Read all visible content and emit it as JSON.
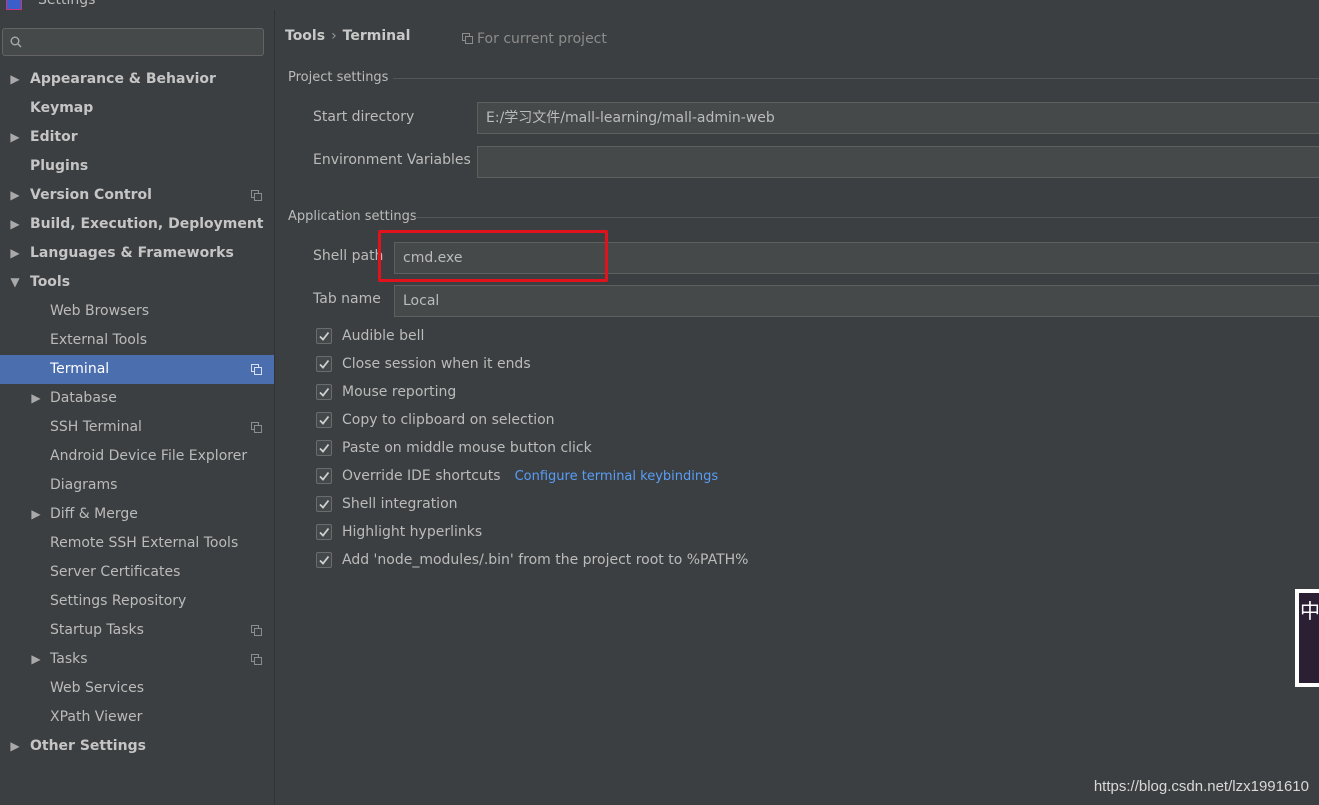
{
  "window": {
    "title": "Settings"
  },
  "search": {
    "placeholder": ""
  },
  "tree": [
    {
      "label": "Appearance & Behavior",
      "arrow": "▶",
      "level": 0,
      "selected": false,
      "project": false
    },
    {
      "label": "Keymap",
      "arrow": "",
      "level": 0,
      "selected": false,
      "project": false
    },
    {
      "label": "Editor",
      "arrow": "▶",
      "level": 0,
      "selected": false,
      "project": false
    },
    {
      "label": "Plugins",
      "arrow": "",
      "level": 0,
      "selected": false,
      "project": false
    },
    {
      "label": "Version Control",
      "arrow": "▶",
      "level": 0,
      "selected": false,
      "project": true
    },
    {
      "label": "Build, Execution, Deployment",
      "arrow": "▶",
      "level": 0,
      "selected": false,
      "project": false
    },
    {
      "label": "Languages & Frameworks",
      "arrow": "▶",
      "level": 0,
      "selected": false,
      "project": false
    },
    {
      "label": "Tools",
      "arrow": "▼",
      "level": 0,
      "selected": false,
      "project": false
    },
    {
      "label": "Web Browsers",
      "arrow": "",
      "level": 1,
      "selected": false,
      "project": false
    },
    {
      "label": "External Tools",
      "arrow": "",
      "level": 1,
      "selected": false,
      "project": false
    },
    {
      "label": "Terminal",
      "arrow": "",
      "level": 1,
      "selected": true,
      "project": true
    },
    {
      "label": "Database",
      "arrow": "▶",
      "level": 1,
      "selected": false,
      "project": false
    },
    {
      "label": "SSH Terminal",
      "arrow": "",
      "level": 1,
      "selected": false,
      "project": true
    },
    {
      "label": "Android Device File Explorer",
      "arrow": "",
      "level": 1,
      "selected": false,
      "project": false
    },
    {
      "label": "Diagrams",
      "arrow": "",
      "level": 1,
      "selected": false,
      "project": false
    },
    {
      "label": "Diff & Merge",
      "arrow": "▶",
      "level": 1,
      "selected": false,
      "project": false
    },
    {
      "label": "Remote SSH External Tools",
      "arrow": "",
      "level": 1,
      "selected": false,
      "project": false
    },
    {
      "label": "Server Certificates",
      "arrow": "",
      "level": 1,
      "selected": false,
      "project": false
    },
    {
      "label": "Settings Repository",
      "arrow": "",
      "level": 1,
      "selected": false,
      "project": false
    },
    {
      "label": "Startup Tasks",
      "arrow": "",
      "level": 1,
      "selected": false,
      "project": true
    },
    {
      "label": "Tasks",
      "arrow": "▶",
      "level": 1,
      "selected": false,
      "project": true
    },
    {
      "label": "Web Services",
      "arrow": "",
      "level": 1,
      "selected": false,
      "project": false
    },
    {
      "label": "XPath Viewer",
      "arrow": "",
      "level": 1,
      "selected": false,
      "project": false
    },
    {
      "label": "Other Settings",
      "arrow": "▶",
      "level": 0,
      "selected": false,
      "project": false
    }
  ],
  "breadcrumb": {
    "part1": "Tools",
    "separator": "›",
    "part2": "Terminal"
  },
  "for_project": "For current project",
  "project_settings": {
    "title": "Project settings",
    "start_directory_label": "Start directory",
    "start_directory_value": "E:/学习文件/mall-learning/mall-admin-web",
    "env_label": "Environment Variables",
    "env_value": ""
  },
  "app_settings": {
    "title": "Application settings",
    "shell_path_label": "Shell path",
    "shell_path_value": "cmd.exe",
    "tab_name_label": "Tab name",
    "tab_name_value": "Local"
  },
  "checkboxes": [
    {
      "label": "Audible bell",
      "checked": true,
      "link": ""
    },
    {
      "label": "Close session when it ends",
      "checked": true,
      "link": ""
    },
    {
      "label": "Mouse reporting",
      "checked": true,
      "link": ""
    },
    {
      "label": "Copy to clipboard on selection",
      "checked": true,
      "link": ""
    },
    {
      "label": "Paste on middle mouse button click",
      "checked": true,
      "link": ""
    },
    {
      "label": "Override IDE shortcuts",
      "checked": true,
      "link": "Configure terminal keybindings"
    },
    {
      "label": "Shell integration",
      "checked": true,
      "link": ""
    },
    {
      "label": "Highlight hyperlinks",
      "checked": true,
      "link": ""
    },
    {
      "label": "Add 'node_modules/.bin' from the project root to %PATH%",
      "checked": true,
      "link": ""
    }
  ],
  "watermark": "https://blog.csdn.net/lzx1991610",
  "overlay_glyph": "中"
}
